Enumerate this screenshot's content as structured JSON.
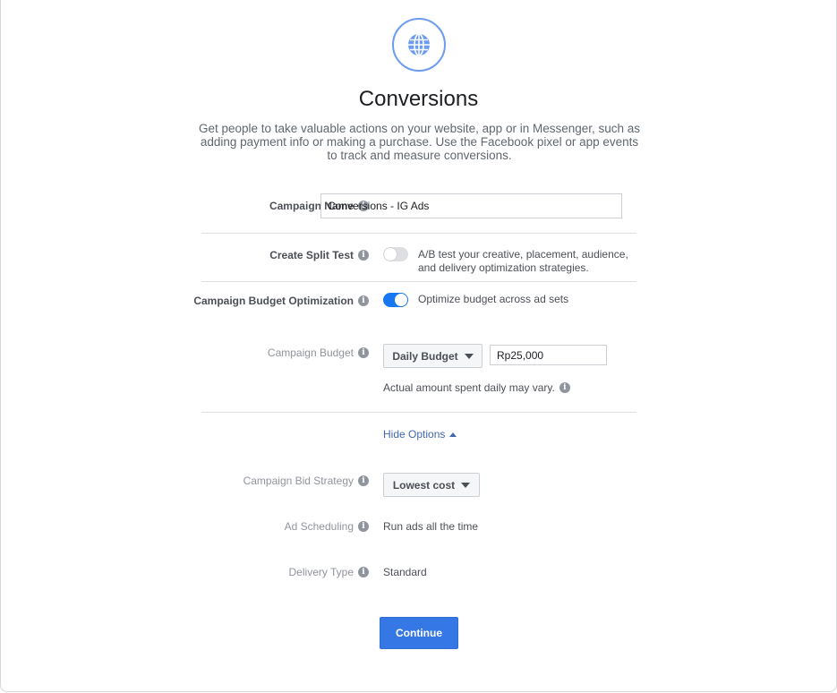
{
  "objective": {
    "icon": "globe-icon",
    "title": "Conversions",
    "description": "Get people to take valuable actions on your website, app or in Messenger, such as adding payment info or making a purchase. Use the Facebook pixel or app events to track and measure conversions."
  },
  "campaign_name": {
    "label": "Campaign Name",
    "value": "Conversions - IG Ads"
  },
  "split_test": {
    "label": "Create Split Test",
    "enabled": false,
    "description": "A/B test your creative, placement, audience, and delivery optimization strategies."
  },
  "cbo": {
    "label": "Campaign Budget Optimization",
    "enabled": true,
    "description": "Optimize budget across ad sets"
  },
  "budget": {
    "label": "Campaign Budget",
    "type": "Daily Budget",
    "amount": "Rp25,000",
    "note": "Actual amount spent daily may vary."
  },
  "hide_options": "Hide Options",
  "bid_strategy": {
    "label": "Campaign Bid Strategy",
    "value": "Lowest cost"
  },
  "ad_scheduling": {
    "label": "Ad Scheduling",
    "value": "Run ads all the time"
  },
  "delivery_type": {
    "label": "Delivery Type",
    "value": "Standard"
  },
  "continue_label": "Continue",
  "colors": {
    "accent": "#3578e5",
    "link": "#4267b2",
    "toggle_on": "#1877f2",
    "toggle_off": "#dddfe2"
  }
}
